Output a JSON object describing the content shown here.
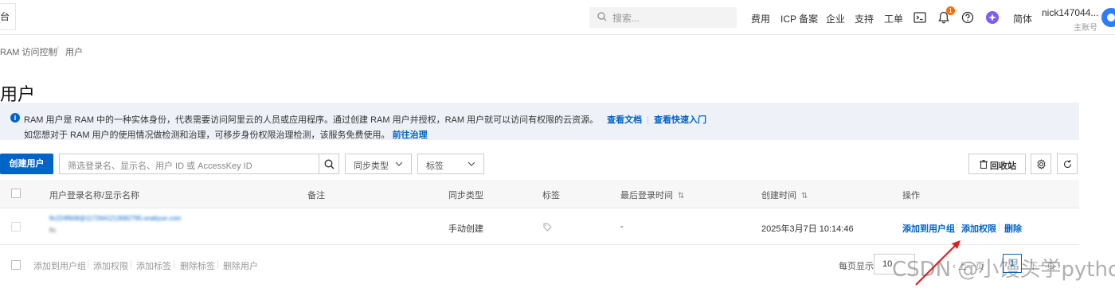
{
  "topbar": {
    "console_tab": "台",
    "search_placeholder": "搜索...",
    "nav": [
      "费用",
      "ICP 备案",
      "企业",
      "支持",
      "工单"
    ],
    "notification_count": "1",
    "language": "简体",
    "user_name": "nick147044...",
    "user_role": "主账号"
  },
  "breadcrumb": [
    "RAM 访问控制",
    "用户"
  ],
  "page_title": "用户",
  "banner": {
    "line1": "RAM 用户是 RAM 中的一种实体身份，代表需要访问阿里云的人员或应用程序。通过创建 RAM 用户并授权，RAM 用户就可以访问有权限的云资源。",
    "link_docs": "查看文档",
    "link_quickstart": "查看快速入门",
    "line2": "如您想对于 RAM 用户的使用情况做检测和治理，可移步身份权限治理检测，该服务免费使用。",
    "link_govern": "前往治理"
  },
  "toolbar": {
    "create_user": "创建用户",
    "filter_placeholder": "筛选登录名、显示名、用户 ID 或 AccessKey ID",
    "sync_type": "同步类型",
    "tag": "标签",
    "recycle_bin": "回收站"
  },
  "table": {
    "headers": [
      "用户登录名称/显示名称",
      "备注",
      "同步类型",
      "标签",
      "最后登录时间",
      "创建时间",
      "操作"
    ],
    "rows": [
      {
        "login_name": "ftc224f608@1172641213682795.onaliyun.com",
        "display_name": "ftc",
        "sync_type": "手动创建",
        "last_login": "-",
        "created": "2025年3月7日 10:14:46",
        "actions": [
          "添加到用户组",
          "添加权限",
          "删除"
        ]
      }
    ]
  },
  "footer": {
    "bulk_actions": [
      "添加到用户组",
      "添加权限",
      "添加标签",
      "删除标签",
      "删除用户"
    ],
    "per_page_label": "每页显示",
    "per_page": "10",
    "prev": "‹ 上一页",
    "current_page": "1",
    "next": "下一页 ›"
  },
  "watermark": "CSDN @小馒头学python",
  "colors": {
    "primary": "#0064c8",
    "banner_bg": "#eef2f8",
    "badge": "#ff6a00",
    "arrow": "#e02020"
  }
}
